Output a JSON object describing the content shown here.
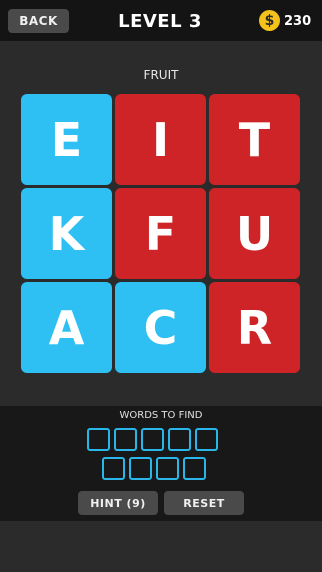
{
  "header": {
    "back_label": "BACK",
    "level_title": "LEVEL 3",
    "coin_symbol": "$",
    "coins": "230"
  },
  "puzzle": {
    "category": "FRUIT",
    "tiles": [
      {
        "letter": "E",
        "color": "blue"
      },
      {
        "letter": "I",
        "color": "red"
      },
      {
        "letter": "T",
        "color": "red"
      },
      {
        "letter": "K",
        "color": "blue"
      },
      {
        "letter": "F",
        "color": "red"
      },
      {
        "letter": "U",
        "color": "red"
      },
      {
        "letter": "A",
        "color": "blue"
      },
      {
        "letter": "C",
        "color": "blue"
      },
      {
        "letter": "R",
        "color": "red"
      }
    ]
  },
  "answer": {
    "label": "WORDS TO FIND",
    "rows": [
      5,
      4
    ]
  },
  "actions": {
    "hint_label": "HINT (9)",
    "reset_label": "RESET"
  },
  "colors": {
    "blue": "#2ec0f2",
    "red": "#cf2427",
    "coin": "#f4c21b",
    "slot_border": "#2ab6e8"
  }
}
